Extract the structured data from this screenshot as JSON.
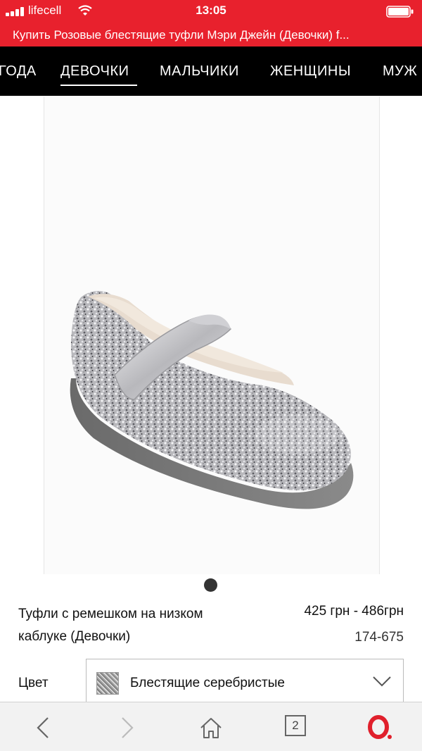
{
  "status": {
    "carrier": "lifecell",
    "time": "13:05"
  },
  "page": {
    "title": "Купить Розовые блестящие туфли Мэри Джейн (Девочки) f..."
  },
  "nav": {
    "items": [
      {
        "label": "ГОДА"
      },
      {
        "label": "ДЕВОЧКИ",
        "active": true
      },
      {
        "label": "МАЛЬЧИКИ"
      },
      {
        "label": "ЖЕНЩИНЫ"
      },
      {
        "label": "МУЖ"
      }
    ]
  },
  "product": {
    "name": "Туфли с ремешком на низком каблуке (Девочки)",
    "price": "425 грн - 486грн",
    "sku": "174-675",
    "image_icon": "glitter-mary-jane-shoe"
  },
  "color": {
    "label": "Цвет",
    "selected": "Блестящие серебристые"
  },
  "toolbar": {
    "tab_count": "2"
  },
  "colors": {
    "brand_red": "#e8212d",
    "nav_bg": "#000000",
    "opera_red": "#e0202c"
  }
}
